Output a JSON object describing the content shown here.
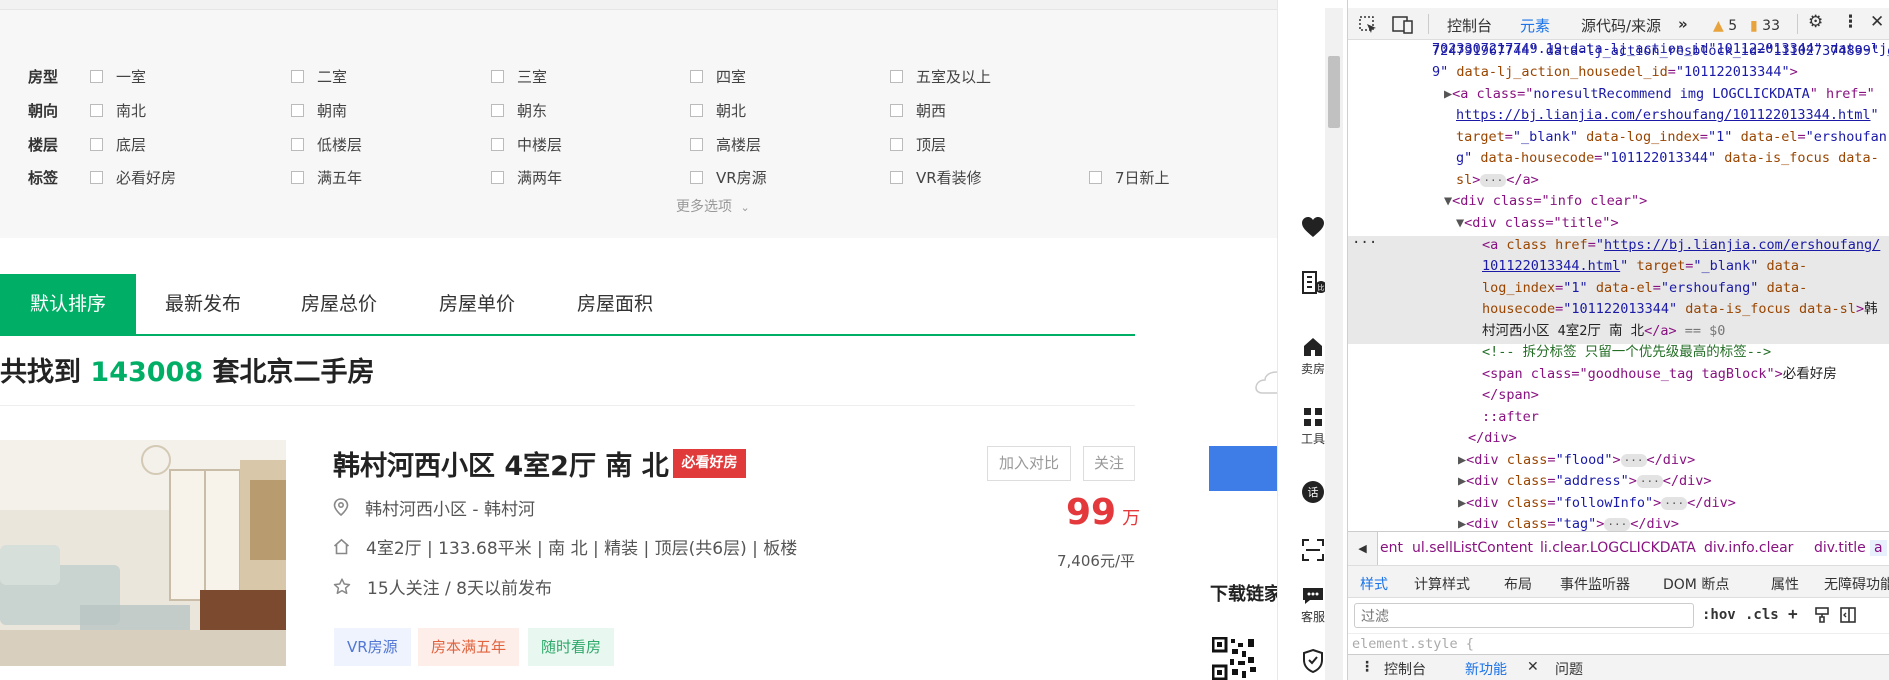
{
  "filters": {
    "rows": [
      {
        "label": "房型",
        "options": [
          "一室",
          "二室",
          "三室",
          "四室",
          "五室及以上"
        ]
      },
      {
        "label": "朝向",
        "options": [
          "南北",
          "朝南",
          "朝东",
          "朝北",
          "朝西"
        ]
      },
      {
        "label": "楼层",
        "options": [
          "底层",
          "低楼层",
          "中楼层",
          "高楼层",
          "顶层"
        ]
      },
      {
        "label": "标签",
        "options": [
          "必看好房",
          "满五年",
          "满两年",
          "VR房源",
          "VR看装修",
          "7日新上"
        ]
      }
    ],
    "more": "更多选项"
  },
  "sort_tabs": [
    "默认排序",
    "最新发布",
    "房屋总价",
    "房屋单价",
    "房屋面积"
  ],
  "count": {
    "prefix": "共找到 ",
    "number": "143008",
    "suffix": " 套北京二手房"
  },
  "listing": {
    "title": "韩村河西小区 4室2厅 南 北",
    "badge": "必看好房",
    "compare": "加入对比",
    "follow": "关注",
    "location": "韩村河西小区 - 韩村河",
    "house_info": "4室2厅 | 133.68平米 | 南 北 | 精装 | 顶层(共6层) | 板楼",
    "follow_info": "15人关注 / 8天以前发布",
    "price": "99",
    "price_unit": "万",
    "unit_price": "7,406元/平",
    "tags": [
      "VR房源",
      "房本满五年",
      "随时看房"
    ]
  },
  "rail": {
    "sell": "卖房",
    "tools": "工具",
    "service": "客服",
    "download": "下载链家"
  },
  "devtools": {
    "tabs": [
      "控制台",
      "元素",
      "源代码/来源"
    ],
    "warnings": "5",
    "issues": "33",
    "dom_lines": {
      "l0": "724791967744\" data-lj_action_resblock_id=\"111027374899\" data-lj_action_housedel_id=\"101122013344\">",
      "l1a": "<a class=\"",
      "l1b": "noresultRecommend img LOGCLICKDATA",
      "l1c": "\" href=\"",
      "l1d": "https://bj.lianjia.com/ershoufang/101122013344.html",
      "l1e": "target=\"_blank\" data-log_index=\"1\" data-el=\"ershoufang\" data-housecode=\"101122013344\" data-is_focus data-sl>",
      "div_info": "<div class=\"info clear\">",
      "div_title": "<div class=\"title\">",
      "a_href": "https://bj.lianjia.com/ershoufang/101122013344.html",
      "a_rest": "\" target=\"_blank\" data-log_index=\"1\" data-el=\"ershoufang\" data-housecode=\"101122013344\" data-is_focus data-sl>",
      "a_text": "韩村河西小区 4室2厅 南 北",
      "eq": "== $0",
      "comment": "<!-- 拆分标签 只留一个优先级最高的标签-->",
      "span_open": "<span class=\"goodhouse_tag tagBlock\">",
      "span_text": "必看好房",
      "span_close": "</span>",
      "after": "::after",
      "div_close": "</div>",
      "flood": "flood",
      "address": "address",
      "followInfo": "followInfo",
      "tag": "tag"
    },
    "crumbs": [
      "ent",
      "ul.sellListContent",
      "li.clear.LOGCLICKDATA",
      "div.info.clear",
      "div.title",
      "a"
    ],
    "sub_tabs": [
      "样式",
      "计算样式",
      "布局",
      "事件监听器",
      "DOM 断点",
      "属性",
      "无障碍功能"
    ],
    "filter_placeholder": "过滤",
    "hov": ":hov",
    "cls": ".cls",
    "element_style": "element.style {",
    "drawer_tabs": [
      "控制台",
      "新功能",
      "问题"
    ]
  }
}
